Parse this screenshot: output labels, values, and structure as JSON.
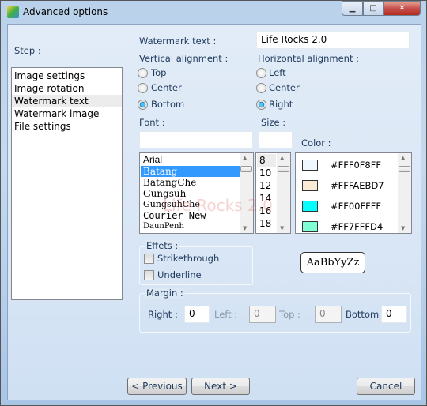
{
  "window": {
    "title": "Advanced options",
    "minimize": "▁",
    "maximize": "□",
    "close": "✕"
  },
  "steps": {
    "label": "Step :",
    "items": [
      "Image settings",
      "Image rotation",
      "Watermark text",
      "Watermark image",
      "File settings"
    ],
    "selected": "Watermark text"
  },
  "watermark": {
    "label": "Watermark text :",
    "value": "Life Rocks 2.0"
  },
  "vertical": {
    "label": "Vertical alignment :",
    "options": [
      "Top",
      "Center",
      "Bottom"
    ],
    "selected": "Bottom"
  },
  "horizontal": {
    "label": "Horizontal alignment :",
    "options": [
      "Left",
      "Center",
      "Right"
    ],
    "selected": "Right"
  },
  "font": {
    "label": "Font :",
    "value": "",
    "items": [
      "Arial",
      "Batang",
      "BatangChe",
      "Gungsuh",
      "GungsuhChe",
      "Courier New",
      "DaunPenh"
    ],
    "selected": "Batang"
  },
  "size": {
    "label": "Size :",
    "value": "",
    "items": [
      "8",
      "10",
      "12",
      "14",
      "16",
      "18"
    ],
    "selected": "8"
  },
  "color": {
    "label": "Color :",
    "items": [
      {
        "name": "#FFF0F8FF",
        "hex": "#F0F8FF"
      },
      {
        "name": "#FFFAEBD7",
        "hex": "#FAEBD7"
      },
      {
        "name": "#FF00FFFF",
        "hex": "#00FFFF"
      },
      {
        "name": "#FF7FFFD4",
        "hex": "#7FFFD4"
      }
    ]
  },
  "effects": {
    "label": "Effets :",
    "strikethrough": "Strikethrough",
    "underline": "Underline",
    "strikethrough_checked": false,
    "underline_checked": false
  },
  "preview": {
    "text": "AaBbYyZz",
    "watermark_overlay": "Life Rocks 2.0"
  },
  "margin": {
    "label": "Margin :",
    "right_label": "Right :",
    "right": "0",
    "left_label": "Left :",
    "left": "0",
    "top_label": "Top :",
    "top": "0",
    "bottom_label": "Bottom",
    "bottom": "0"
  },
  "buttons": {
    "previous": "< Previous",
    "next": "Next >",
    "cancel": "Cancel"
  }
}
